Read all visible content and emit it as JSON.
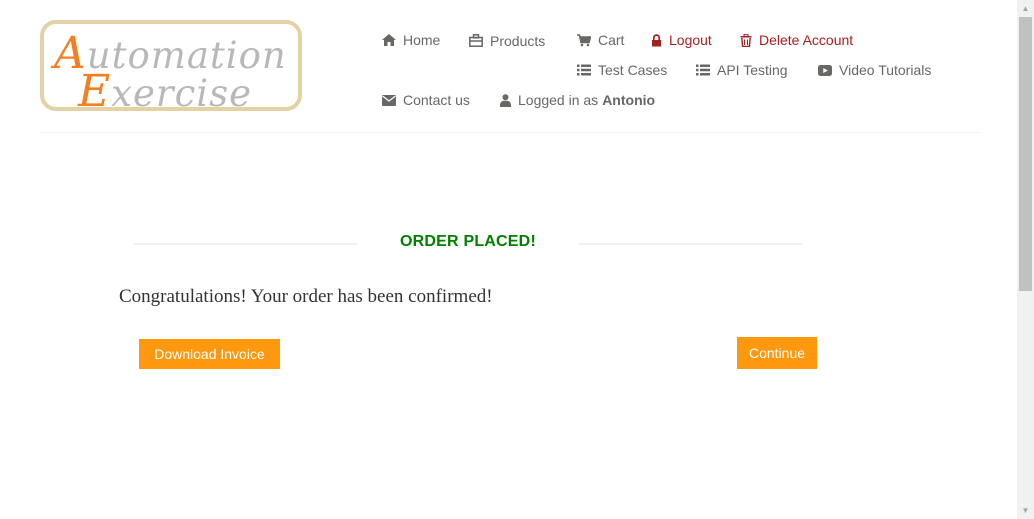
{
  "logo": {
    "cap1": "A",
    "rest1": "utomation",
    "cap2": "E",
    "rest2": "xercise",
    "colors": {
      "accent": "#f57e20",
      "text": "#b8b8b8",
      "border": "#e3d2a5"
    }
  },
  "nav": {
    "home": "Home",
    "products": "Products",
    "cart": "Cart",
    "logout": "Logout",
    "delete_account": "Delete Account",
    "test_cases": "Test Cases",
    "api_testing": "API Testing",
    "video_tutorials": "Video Tutorials",
    "contact_us": "Contact us",
    "logged_in_prefix": "Logged in as",
    "username": "Antonio",
    "icons": {
      "home": "home-icon",
      "products": "products-icon",
      "cart": "cart-icon",
      "logout": "lock-icon",
      "delete_account": "trash-icon",
      "test_cases": "list-icon",
      "api_testing": "list-icon",
      "video_tutorials": "youtube-icon",
      "contact_us": "envelope-icon",
      "user": "user-icon"
    }
  },
  "order": {
    "title": "ORDER PLACED!",
    "message": "Congratulations! Your order has been confirmed!",
    "download_invoice": "Download Invoice",
    "continue": "Continue"
  },
  "scrollbar": {
    "up_arrow": "▲",
    "down_arrow": "▼"
  },
  "colors": {
    "nav_text": "#696763",
    "danger": "#a72020",
    "success": "#008000",
    "button": "#fe980f"
  }
}
